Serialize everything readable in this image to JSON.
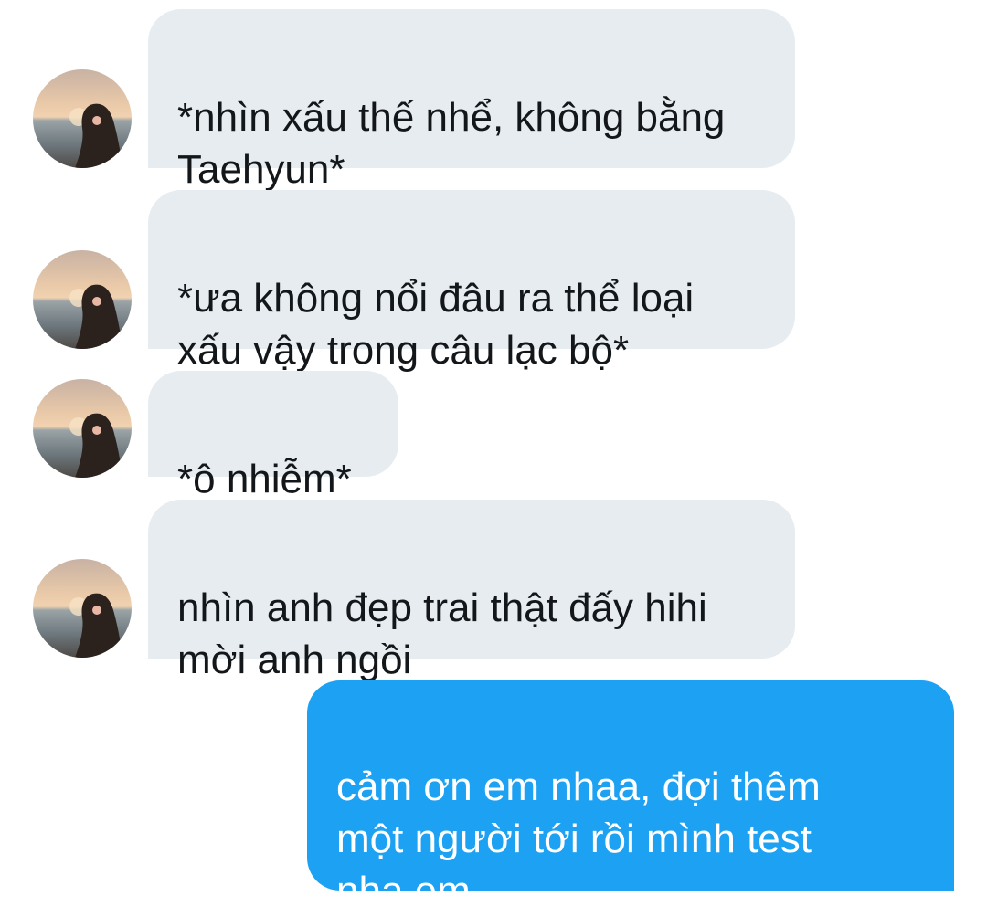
{
  "messages": [
    {
      "direction": "received",
      "text": "*nhìn xấu thế nhể, không bằng\nTaehyun*"
    },
    {
      "direction": "received",
      "text": "*ưa không nổi đâu ra thể loại\nxấu vậy trong câu lạc bộ*"
    },
    {
      "direction": "received",
      "text": "*ô nhiễm*"
    },
    {
      "direction": "received",
      "text": "nhìn anh đẹp trai thật đấy hihi\nmời anh ngồi"
    },
    {
      "direction": "sent",
      "text": "cảm ơn em nhaa, đợi thêm\nmột người tới rồi mình test\nnha em"
    }
  ],
  "colors": {
    "received_bubble": "#e6ecf0",
    "sent_bubble": "#1da1f2",
    "received_text": "#14171a",
    "sent_text": "#ffffff"
  },
  "avatar_icon": "profile-photo-girl-at-beach-sunset"
}
